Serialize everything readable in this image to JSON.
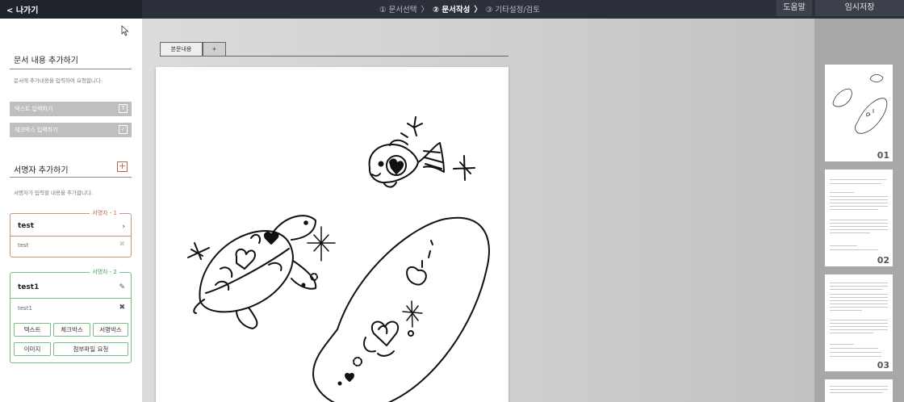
{
  "topbar": {
    "back_label": "< 나가기",
    "steps": [
      "① 문서선택",
      "② 문서작성",
      "③ 기타설정/검토"
    ],
    "step_sep": "〉",
    "help_label": "도움말",
    "save_label": "임시저장"
  },
  "left": {
    "content_title": "문서 내용 추가하기",
    "content_desc": "문서에 추가내용을 입력하여 요청합니다.",
    "text_input_label": "텍스트 입력하기",
    "checkbox_input_label": "체크박스 입력하기",
    "signer_title": "서명자 추가하기",
    "signer_desc": "서명자가 입력할 내용을 추가합니다.",
    "signers": [
      {
        "legend": "서명자 - 1",
        "name": "test",
        "sub": "test"
      },
      {
        "legend": "서명자 - 2",
        "name": "test1",
        "sub": "test1"
      }
    ],
    "signer2_buttons": [
      "텍스트",
      "체크박스",
      "서명박스",
      "이미지",
      "첨부파일 요청"
    ]
  },
  "main": {
    "tabs": [
      "본문내용",
      "+"
    ]
  },
  "thumbnails": [
    {
      "num": "01"
    },
    {
      "num": "02"
    },
    {
      "num": "03"
    }
  ],
  "colors": {
    "topbar": "#2b303b",
    "signer1_accent": "#b8684a",
    "signer2_accent": "#4a9a52"
  }
}
